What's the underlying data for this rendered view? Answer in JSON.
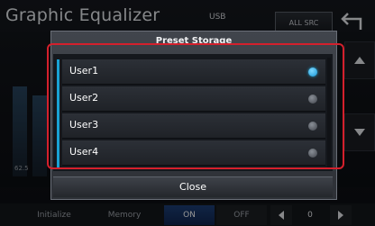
{
  "app": {
    "title": "Graphic Equalizer",
    "source": "USB",
    "all_src_label": "ALL SRC"
  },
  "eq_background": {
    "freq_labels": [
      "62.5"
    ]
  },
  "bottom_bar": {
    "initialize_label": "Initialize",
    "memory_label": "Memory",
    "on_label": "ON",
    "off_label": "OFF",
    "value": "0"
  },
  "dialog": {
    "title": "Preset Storage",
    "items": [
      {
        "label": "User1",
        "selected": true
      },
      {
        "label": "User2",
        "selected": false
      },
      {
        "label": "User3",
        "selected": false
      },
      {
        "label": "User4",
        "selected": false
      }
    ],
    "close_label": "Close"
  },
  "colors": {
    "accent": "#1aa2d4",
    "highlight": "#d4202c",
    "on_button": "#1d3f78"
  },
  "icons": {
    "back": "back-arrow-icon",
    "scroll_up": "triangle-up-icon",
    "scroll_down": "triangle-down-icon",
    "prev": "triangle-left-icon",
    "next": "triangle-right-icon"
  }
}
